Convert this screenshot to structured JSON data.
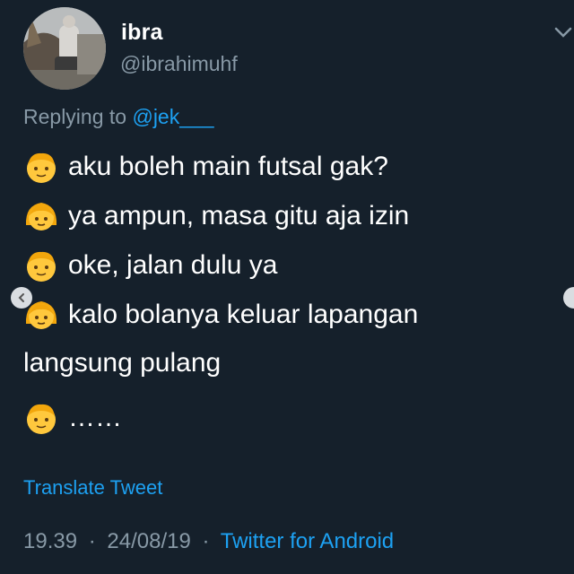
{
  "user": {
    "display_name": "ibra",
    "handle": "@ibrahimuhf"
  },
  "reply": {
    "prefix": "Replying to",
    "mention": "@jek___"
  },
  "tweet_lines": [
    {
      "emoji": "boy-face-icon",
      "text": "aku boleh main futsal gak?"
    },
    {
      "emoji": "girl-face-icon",
      "text": "ya ampun, masa gitu aja izin"
    },
    {
      "emoji": "boy-face-icon",
      "text": "oke, jalan dulu ya"
    },
    {
      "emoji": "girl-face-icon",
      "text": "kalo bolanya keluar lapangan"
    },
    {
      "emoji": "",
      "text": "langsung pulang"
    },
    {
      "emoji": "boy-face-icon",
      "text": "……"
    }
  ],
  "translate_label": "Translate Tweet",
  "meta": {
    "time": "19.39",
    "date": "24/08/19",
    "client": "Twitter for Android",
    "separator": "·"
  },
  "colors": {
    "background": "#15202b",
    "text": "#ffffff",
    "muted": "#8899a6",
    "accent": "#1da1f2"
  }
}
